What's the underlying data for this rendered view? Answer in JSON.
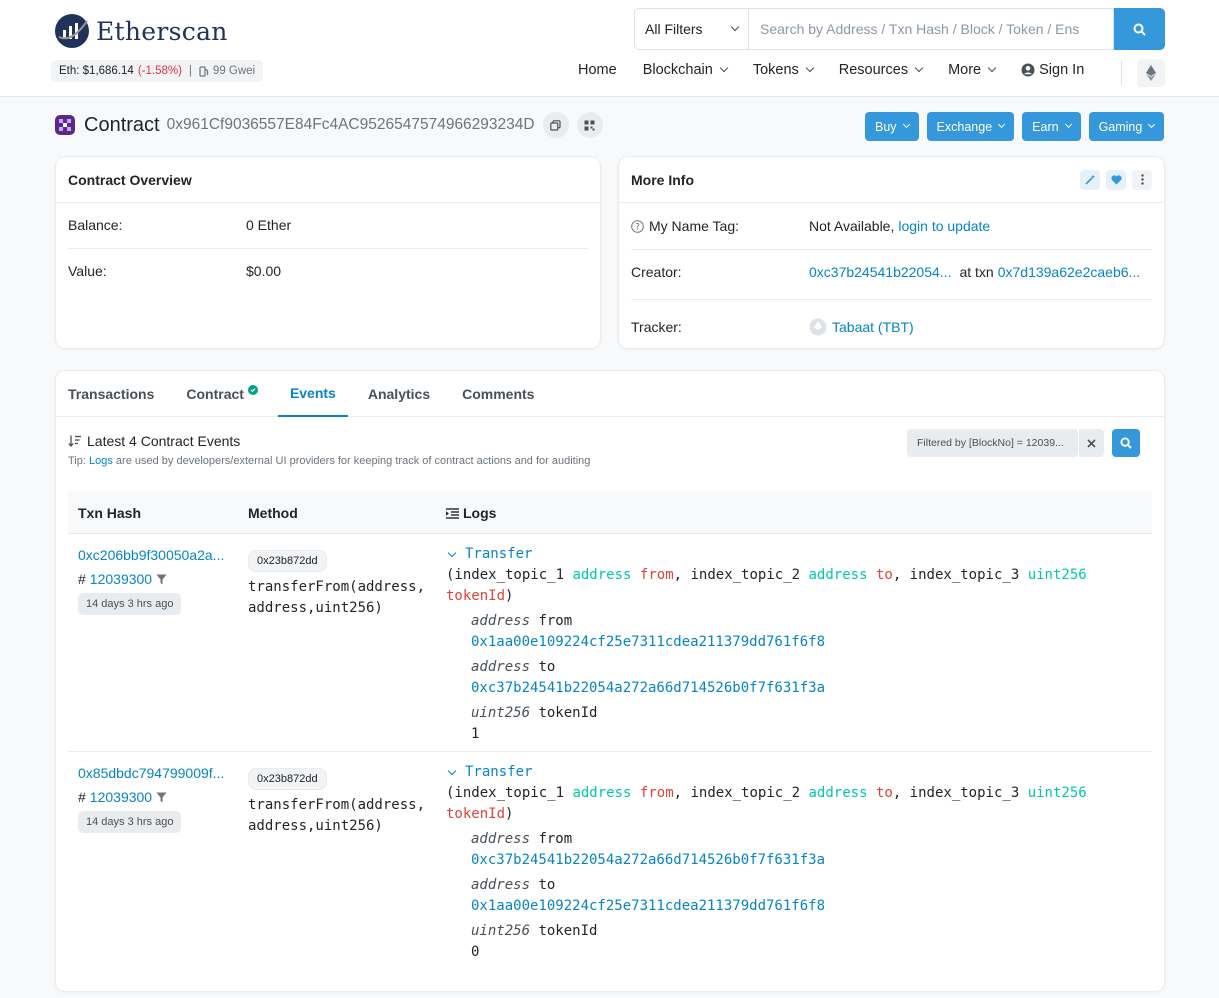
{
  "header": {
    "logo_text": "Etherscan",
    "price_label": "Eth: $1,686.14",
    "price_change": "(-1.58%)",
    "separator": "|",
    "gas": "99 Gwei",
    "filter_selected": "All Filters",
    "search_placeholder": "Search by Address / Txn Hash / Block / Token / Ens",
    "nav": {
      "home": "Home",
      "blockchain": "Blockchain",
      "tokens": "Tokens",
      "resources": "Resources",
      "more": "More",
      "sign_in": "Sign In"
    }
  },
  "contract": {
    "label": "Contract",
    "address": "0x961Cf9036557E84Fc4AC9526547574966293234D",
    "buttons": {
      "buy": "Buy",
      "exchange": "Exchange",
      "earn": "Earn",
      "gaming": "Gaming"
    }
  },
  "overview": {
    "title": "Contract Overview",
    "balance_label": "Balance:",
    "balance_value": "0 Ether",
    "value_label": "Value:",
    "value_value": "$0.00"
  },
  "more_info": {
    "title": "More Info",
    "name_tag_label": "My Name Tag:",
    "name_tag_value": "Not Available,",
    "name_tag_link": "login to update",
    "creator_label": "Creator:",
    "creator_address": "0xc37b24541b22054...",
    "creator_at_txn": "at txn",
    "creator_txn": "0x7d139a62e2caeb6...",
    "tracker_label": "Tracker:",
    "tracker_value": "Tabaat (TBT)"
  },
  "tabs": {
    "transactions": "Transactions",
    "contract": "Contract",
    "events": "Events",
    "analytics": "Analytics",
    "comments": "Comments"
  },
  "events": {
    "title": "Latest 4 Contract Events",
    "tip_prefix": "Tip:",
    "tip_link": "Logs",
    "tip_text": "are used by developers/external UI providers for keeping track of contract actions and for auditing",
    "filter_text": "Filtered by [BlockNo] = 12039...",
    "headers": {
      "txn_hash": "Txn Hash",
      "method": "Method",
      "logs": "Logs"
    },
    "sig": {
      "event": "Transfer",
      "open": "(index_topic_1",
      "type_address": "address",
      "from": "from",
      "comma_topic2": ", index_topic_2",
      "to": "to",
      "comma_topic3": ", index_topic_3",
      "type_uint": "uint256",
      "tokenid": "tokenId",
      "close": ")"
    },
    "rows": [
      {
        "txn_hash": "0xc206bb9f30050a2a...",
        "block_prefix": "#",
        "block": "12039300",
        "age": "14 days 3 hrs ago",
        "method_id": "0x23b872dd",
        "method_sig": "transferFrom(address,address,uint256)",
        "from_addr": "0x1aa00e109224cf25e7311cdea211379dd761f6f8",
        "to_addr": "0xc37b24541b22054a272a66d714526b0f7f631f3a",
        "token_id": "1"
      },
      {
        "txn_hash": "0x85dbdc794799009f...",
        "block_prefix": "#",
        "block": "12039300",
        "age": "14 days 3 hrs ago",
        "method_id": "0x23b872dd",
        "method_sig": "transferFrom(address,address,uint256)",
        "from_addr": "0xc37b24541b22054a272a66d714526b0f7f631f3a",
        "to_addr": "0x1aa00e109224cf25e7311cdea211379dd761f6f8",
        "token_id": "0"
      }
    ]
  },
  "colors": {
    "accent": "#3498db",
    "link": "#0784c3",
    "negative": "#dc3545",
    "teal": "#00c9a7",
    "red_param": "#de4437"
  }
}
